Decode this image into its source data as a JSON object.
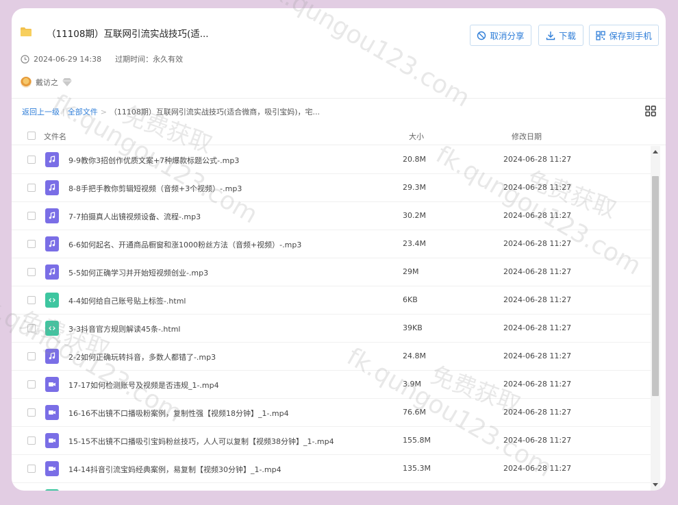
{
  "share": {
    "title": "（11108期）互联网引流实战技巧(适...",
    "created": "2024-06-29 14:38",
    "expire_label": "过期时间：永久有效",
    "user": "戴访之"
  },
  "actions": {
    "cancel_share": "取消分享",
    "download": "下载",
    "save_to_phone": "保存到手机"
  },
  "breadcrumb": {
    "back": "返回上一级",
    "all_files": "全部文件",
    "sep": ">",
    "current": "（11108期）互联网引流实战技巧(适合微商，吸引宝妈)，宅..."
  },
  "columns": {
    "name": "文件名",
    "size": "大小",
    "date": "修改日期"
  },
  "files": [
    {
      "name": "9-9教你3招创作优质文案+7种爆款标题公式-.mp3",
      "size": "20.8M",
      "date": "2024-06-28 11:27",
      "type": "audio"
    },
    {
      "name": "8-8手把手教你剪辑短视频（音频+3个视频）-.mp3",
      "size": "29.3M",
      "date": "2024-06-28 11:27",
      "type": "audio"
    },
    {
      "name": "7-7拍摄真人出镜视频设备、流程-.mp3",
      "size": "30.2M",
      "date": "2024-06-28 11:27",
      "type": "audio"
    },
    {
      "name": "6-6如何起名、开通商品橱窗和涨1000粉丝方法（音频+视频）-.mp3",
      "size": "23.4M",
      "date": "2024-06-28 11:27",
      "type": "audio"
    },
    {
      "name": "5-5如何正确学习并开始短视频创业-.mp3",
      "size": "29M",
      "date": "2024-06-28 11:27",
      "type": "audio"
    },
    {
      "name": "4-4如何给自己账号贴上标签-.html",
      "size": "6KB",
      "date": "2024-06-28 11:27",
      "type": "html"
    },
    {
      "name": "3-3抖音官方规则解读45条-.html",
      "size": "39KB",
      "date": "2024-06-28 11:27",
      "type": "html"
    },
    {
      "name": "2-2如何正确玩转抖音，多数人都错了-.mp3",
      "size": "24.8M",
      "date": "2024-06-28 11:27",
      "type": "audio"
    },
    {
      "name": "17-17如何检测账号及视频是否违规_1-.mp4",
      "size": "3.9M",
      "date": "2024-06-28 11:27",
      "type": "video"
    },
    {
      "name": "16-16不出镜不口播吸粉案例，复制性强【视频18分钟】_1-.mp4",
      "size": "76.6M",
      "date": "2024-06-28 11:27",
      "type": "video"
    },
    {
      "name": "15-15不出镜不口播吸引宝妈粉丝技巧，人人可以复制【视频38分钟】_1-.mp4",
      "size": "155.8M",
      "date": "2024-06-28 11:27",
      "type": "video"
    },
    {
      "name": "14-14抖音引流宝妈经典案例，易复制【视频30分钟】_1-.mp4",
      "size": "135.3M",
      "date": "2024-06-28 11:27",
      "type": "video"
    },
    {
      "name": "",
      "size": "",
      "date": "",
      "type": "html"
    }
  ],
  "watermark": "fk.qungou123.com",
  "watermark2": "免费获取",
  "colors": {
    "accent": "#2f7ed8",
    "audio_icon": "#7a6ee6",
    "html_icon": "#3ec6a0",
    "background": "#e2cde3"
  }
}
